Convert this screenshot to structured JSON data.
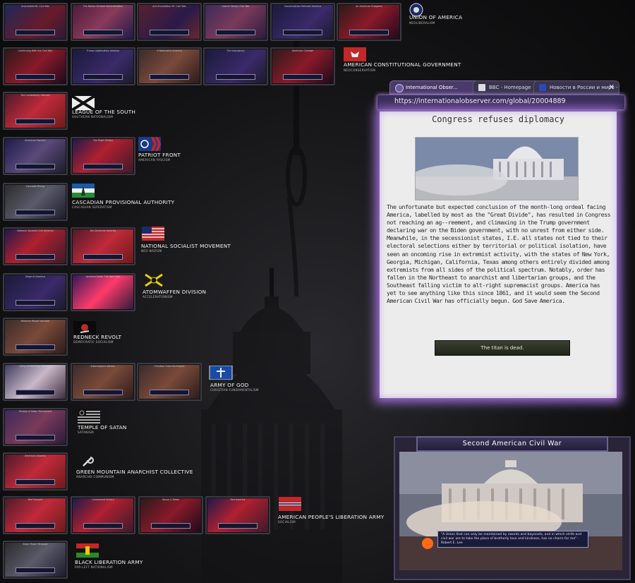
{
  "thumbnail_rows": [
    {
      "row": "r1",
      "titles": [
        "Unenviable Mr. Civil War",
        "The Nation Divided Administration",
        "Anti-Foundation Mr. Civil War",
        "Liberal Victory Civil War",
        "Conservatives Remove America",
        "An American Endgame"
      ]
    },
    {
      "row": "r2",
      "titles": [
        "Continuing With the Civil War",
        "Trump Legitimately America",
        "A Nationalist America",
        "The Insurgency",
        "American Carnage"
      ]
    },
    {
      "row": "r3",
      "titles": [
        "The Confederacy Returns"
      ]
    },
    {
      "row": "r4",
      "titles": [
        "American Fascism",
        "The Right Strikes"
      ]
    },
    {
      "row": "r5",
      "titles": [
        "Cascadia Rising"
      ]
    },
    {
      "row": "r6",
      "titles": [
        "National Socialist Civil America",
        "Die Deutsche Amerika"
      ]
    },
    {
      "row": "r7",
      "titles": [
        "Siege of America",
        "America Under The Dark Sun"
      ]
    },
    {
      "row": "r8",
      "titles": [
        "Redneck Revolt Vaunted"
      ]
    },
    {
      "row": "r9",
      "titles": [
        "Army of God Holy Civil War",
        "Interreligious Vatican",
        "Christian Onto the Empire"
      ]
    },
    {
      "row": "r10",
      "titles": [
        "Temple of Satan Triumphant"
      ]
    },
    {
      "row": "r11",
      "titles": [
        "American Anarchy"
      ]
    },
    {
      "row": "r12",
      "titles": [
        "Red Tsunami",
        "Communist Victory",
        "Rouse & Rebel",
        "Red America"
      ]
    },
    {
      "row": "r13",
      "titles": [
        "Black Power Renewal"
      ]
    }
  ],
  "factions": [
    {
      "name": "UNION OF AMERICA",
      "ideology": "NEOLIBERALISM"
    },
    {
      "name": "AMERICAN CONSTITUTIONAL GOVERNMENT",
      "ideology": "NEOCONSERVATISM"
    },
    {
      "name": "LEAGUE OF THE SOUTH",
      "ideology": "SOUTHERN NATIONALISM"
    },
    {
      "name": "PATRIOT FRONT",
      "ideology": "AMERICAN FASCISM"
    },
    {
      "name": "CASCADIAN PROVISIONAL AUTHORITY",
      "ideology": "CASCADIAN SEPERATISM"
    },
    {
      "name": "NATIONAL SOCIALIST MOVEMENT",
      "ideology": "NEO-NAZISM"
    },
    {
      "name": "ATOMWAFFEN DIVISION",
      "ideology": "ACCELERATIONISM"
    },
    {
      "name": "REDNECK REVOLT",
      "ideology": "DEMOCRATIC SOCIALISM"
    },
    {
      "name": "ARMY OF GOD",
      "ideology": "CHRISTIAN FUNDAMENTALISM"
    },
    {
      "name": "TEMPLE OF SATAN",
      "ideology": "SATANISM"
    },
    {
      "name": "GREEN MOUNTAIN ANARCHIST COLLECTIVE",
      "ideology": "ANARCHO-COMMUNISM"
    },
    {
      "name": "AMERICAN PEOPLE'S LIBERATION ARMY",
      "ideology": "SOCIALISM"
    },
    {
      "name": "BLACK LIBERATION ARMY",
      "ideology": "FAR-LEFT NATIONALISM"
    }
  ],
  "browser": {
    "tabs": [
      "International Obser...",
      "BBC - Homepage",
      "Новости в России и мире - ТА..."
    ],
    "url": "https://internationalobserver.com/global/20004889",
    "headline": "Congress refuses diplomacy",
    "article": "The unfortunate but expected conclusion of the month-long ordeal facing America, labelled by most as the \"Great Divide\", has resulted in Congress not reaching an ag--reement, and climaxing in the Trump government declaring war on the Biden government, with no unrest from either side. Meanwhile, in the secessionist states, I.E. all states not tied to their electoral selections either by territorial or political isolation, have seen an oncoming rise in extremist activity, with the states of New York, Georgia, Michigan, California, Texas among others entirely divided among extremists from all sides of the political spectrum. Notably, order has fallen in the Northeast to anarchist and libertarian groups, and the Southeast falling victim to alt-right supremacist groups. America has yet to see anything like this since 1861, and it would seem the Second American Civil War has officially begun. God Save America.",
    "button": "The titan is dead."
  },
  "event": {
    "title": "Second American Civil War",
    "quote": "\"A Union that can only be maintained by swords and bayonets, and in which strife and civil war are to take the place of brotherly love and kindness, has no charm for me\" - Robert E. Lee"
  }
}
